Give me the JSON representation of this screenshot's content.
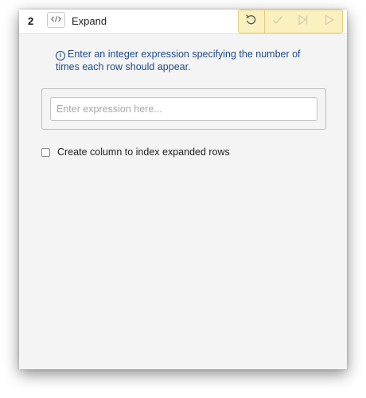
{
  "step": {
    "number": "2",
    "title": "Expand"
  },
  "toolbar": {
    "undo": "undo-icon",
    "apply": "check-icon",
    "step_forward": "step-forward-icon",
    "run": "play-icon"
  },
  "info": {
    "text": "Enter an integer expression specifying the number of times each row should appear."
  },
  "expression": {
    "placeholder": "Enter expression here...",
    "value": ""
  },
  "index_option": {
    "label": "Create column to index expanded rows",
    "checked": false
  },
  "colors": {
    "toolbar_bg": "#fbf0c0",
    "info_text": "#1f4a8a",
    "panel_bg": "#f4f4f4"
  }
}
